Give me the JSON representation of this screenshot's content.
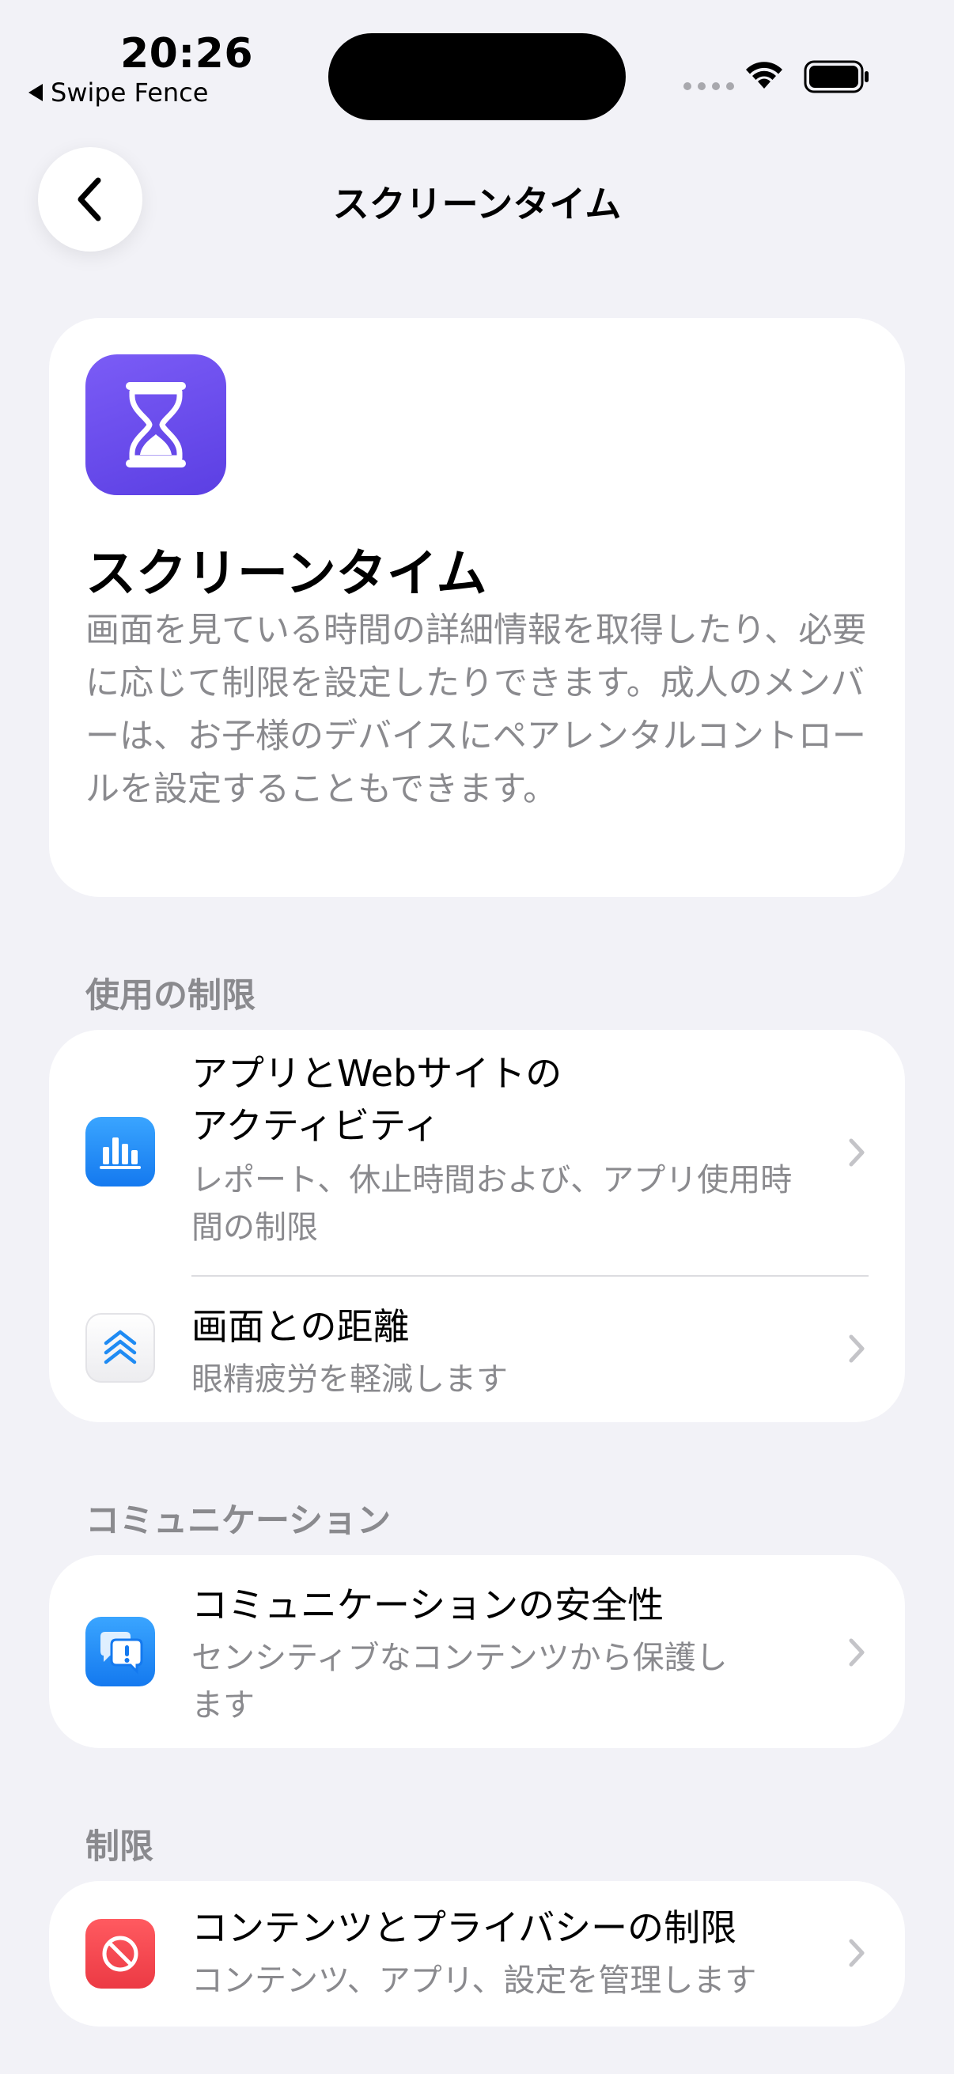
{
  "status_bar": {
    "time": "20:26",
    "back_app": "Swipe Fence"
  },
  "nav": {
    "title": "スクリーンタイム"
  },
  "hero": {
    "icon": "hourglass-icon",
    "title": "スクリーンタイム",
    "description": "画面を見ている時間の詳細情報を取得したり、必要に応じて制限を設定したりできます。成人のメンバーは、お子様のデバイスにペアレンタルコントロールを設定することもできます。"
  },
  "sections": [
    {
      "header": "使用の制限",
      "items": [
        {
          "icon": "bar-chart-icon",
          "title_line1": "アプリとWebサイトの",
          "title_line2": "アクティビティ",
          "subtitle": "レポート、休止時間および、アプリ使用時間の制限"
        },
        {
          "icon": "screen-distance-icon",
          "title": "画面との距離",
          "subtitle": "眼精疲労を軽減します"
        }
      ]
    },
    {
      "header": "コミュニケーション",
      "items": [
        {
          "icon": "message-alert-icon",
          "title": "コミュニケーションの安全性",
          "subtitle": "センシティブなコンテンツから保護します"
        }
      ]
    },
    {
      "header": "制限",
      "items": [
        {
          "icon": "restriction-icon",
          "title": "コンテンツとプライバシーの制限",
          "subtitle": "コンテンツ、アプリ、設定を管理します"
        }
      ]
    }
  ],
  "colors": {
    "background": "#f2f2f7",
    "card": "#ffffff",
    "secondary_text": "#8a8a8e",
    "hero_icon": "#6a4cf0",
    "activity_icon": "#1e8ff6",
    "communication_icon": "#1e8ff6",
    "restriction_icon": "#f0474f"
  }
}
